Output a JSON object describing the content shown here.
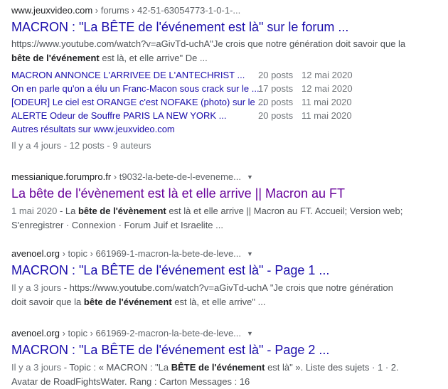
{
  "results": [
    {
      "domain": "www.jeuxvideo.com",
      "path": " › forums › 42-51-63054773-1-0-1-...",
      "title": "MACRON : \"La BÊTE de l'événement est là\" sur le forum ...",
      "snippet_line1": "https://www.youtube.com/watch?v=aGivTd-uchA\"Je crois que notre génération doit savoir que la",
      "snippet_bold": "bête de l'événement",
      "snippet_rest": " est là, et elle arrive\" De ...",
      "sub_rows": [
        {
          "title": "MACRON ANNONCE L'ARRIVEE DE L'ANTECHRIST ...",
          "posts": "20 posts",
          "date": "12 mai 2020"
        },
        {
          "title": "On en parle qu'on a élu un Franc-Macon sous crack sur le ...",
          "posts": "17 posts",
          "date": "12 mai 2020"
        },
        {
          "title": "[ODEUR] Le ciel est ORANGE c'est NOFAKE (photo) sur le ...",
          "posts": "20 posts",
          "date": "11 mai 2020"
        },
        {
          "title": "ALERTE Odeur de Souffre PARIS LA NEW YORK ...",
          "posts": "20 posts",
          "date": "11 mai 2020"
        }
      ],
      "more_results": "Autres résultats sur www.jeuxvideo.com",
      "meta": "Il y a 4 jours - 12 posts - 9 auteurs"
    },
    {
      "domain": "messianique.forumpro.fr",
      "path": " › t9032-la-bete-de-l-eveneme...",
      "title": "La bête de l'évènement est là et elle arrive || Macron au FT",
      "date": "1 mai 2020",
      "sep": " - ",
      "snippet_pre": "La ",
      "snippet_bold": "bête de l'évènement",
      "snippet_post": " est là et elle arrive || Macron au FT. Accueil; Version web;",
      "snippet_line2": "S'enregistrer · Connexion · Forum Juif et Israelite ..."
    },
    {
      "domain": "avenoel.org",
      "path": " › topic › 661969-1-macron-la-bete-de-leve...",
      "title": "MACRON : \"La BÊTE de l'événement est là\" - Page 1 ...",
      "date": "Il y a 3 jours",
      "sep": " - ",
      "snippet_pre": "https://www.youtube.com/watch?v=aGivTd-uchA \"Je crois que notre génération",
      "snippet_line2_pre": "doit savoir que la ",
      "snippet_bold": "bête de l'événement",
      "snippet_post": " est là, et elle arrive\" ..."
    },
    {
      "domain": "avenoel.org",
      "path": " › topic › 661969-2-macron-la-bete-de-leve...",
      "title": "MACRON : \"La BÊTE de l'événement est là\" - Page 2 ...",
      "date": "Il y a 3 jours",
      "sep": " - ",
      "snippet_pre": "Topic : « MACRON : \"La ",
      "snippet_bold": "BÊTE de l'événement",
      "snippet_post": " est là\" ». Liste des sujets · 1 · 2.",
      "snippet_line2": "Avatar de RoadFightsWater. Rang : Carton Messages : 16"
    }
  ],
  "icons": {
    "more": "caret-down-icon"
  },
  "colors": {
    "link": "#1a0dab",
    "visited": "#660099",
    "text": "#4d5156",
    "meta": "#70757a"
  }
}
